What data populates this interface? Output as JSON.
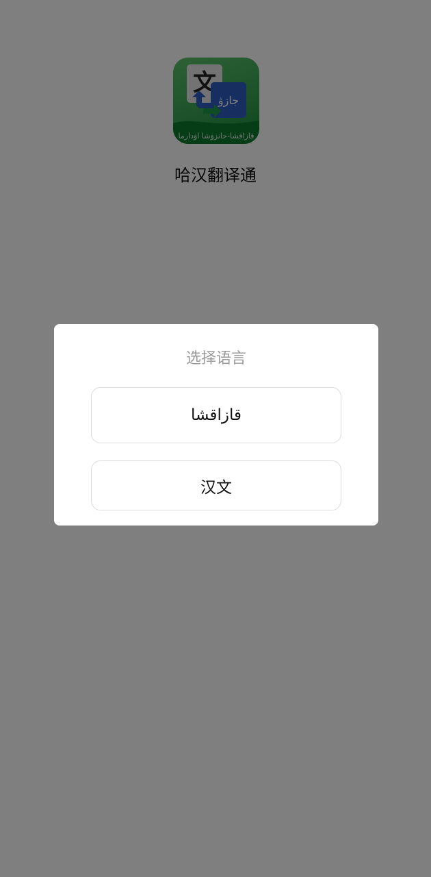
{
  "app": {
    "name": "哈汉翻译通",
    "icon": {
      "glyph_chinese": "文",
      "glyph_kazakh": "جازۋ",
      "banner_text": "قازاقشا-حانزۋشا اۋدارما"
    }
  },
  "dialog": {
    "title": "选择语言",
    "options": [
      {
        "label": "قازاقشا"
      },
      {
        "label": "汉文"
      }
    ]
  },
  "colors": {
    "scrim": "#808080",
    "icon_green": "#3aa353",
    "icon_blue": "#2f5fc0",
    "dialog_title": "#9a9a9a"
  }
}
